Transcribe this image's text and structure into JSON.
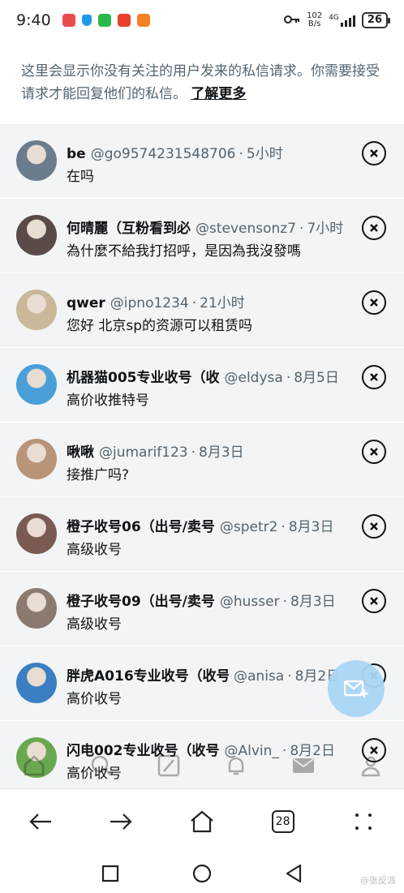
{
  "status_bar": {
    "time": "9:40",
    "speed_value": "102",
    "speed_unit": "B/s",
    "network": "4G",
    "battery": "26"
  },
  "info": {
    "text": "这里会显示你没有关注的用户发来的私信请求。你需要接受请求才能回复他们的私信。",
    "learn_more": "了解更多"
  },
  "requests": [
    {
      "name": "be",
      "handle": "@go9574231548706",
      "time": "5小时",
      "message": "在吗",
      "avatar_color": "#6b7d8c"
    },
    {
      "name": "何晴麗（互粉看到必",
      "handle": "@stevensonz7",
      "time": "7小时",
      "message": "為什麼不給我打招呼，是因為我沒發嗎",
      "avatar_color": "#5a4a48"
    },
    {
      "name": "qwer",
      "handle": "@ipno1234",
      "time": "21小时",
      "message": "您好 北京sp的资源可以租赁吗",
      "avatar_color": "#c9b89a"
    },
    {
      "name": "机器猫005专业收号（收",
      "handle": "@eldysa",
      "time": "8月5日",
      "message": "高价收推特号",
      "avatar_color": "#4a9fd8"
    },
    {
      "name": "啾啾",
      "handle": "@jumarif123",
      "time": "8月3日",
      "message": "接推广吗?",
      "avatar_color": "#b89478"
    },
    {
      "name": "橙子收号06（出号/卖号",
      "handle": "@spetr2",
      "time": "8月3日",
      "message": "高级收号",
      "avatar_color": "#7a5a52"
    },
    {
      "name": "橙子收号09（出号/卖号",
      "handle": "@husser",
      "time": "8月3日",
      "message": "高级收号",
      "avatar_color": "#8a7a70"
    },
    {
      "name": "胖虎A016专业收号（收号",
      "handle": "@anisa",
      "time": "8月2日",
      "message": "高价收号",
      "avatar_color": "#3a7fc2"
    },
    {
      "name": "闪电002专业收号（收号",
      "handle": "@Alvin_",
      "time": "8月2日",
      "message": "高价收号",
      "avatar_color": "#6aa84f"
    }
  ],
  "browser_nav": {
    "tab_count": "28"
  },
  "watermark": "@张反派"
}
